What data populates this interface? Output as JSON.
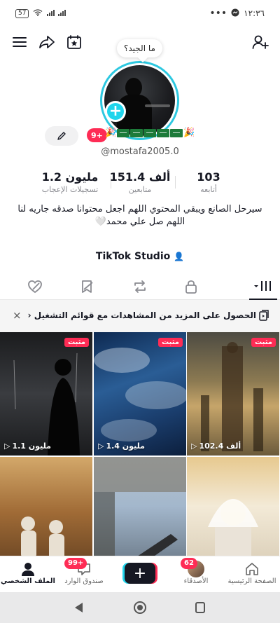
{
  "status_bar": {
    "battery": "57",
    "time": "١٢:٣٦"
  },
  "profile": {
    "bubble_text": "ما الجيد؟",
    "badge_count": "9+",
    "username": "@mostafa2005.0",
    "stats": [
      {
        "value": "103",
        "label": "أتابعه"
      },
      {
        "value": "151.4 ألف",
        "label": "متابعين"
      },
      {
        "value": "1.2 مليون",
        "label": "تسجيلات الإعجاب"
      }
    ],
    "bio_line1": "سيرحل الصانع ويبقي المحتوي اللهم اجعل محتوانا صدقه جاريه لنا",
    "bio_line2": "اللهم صل علي محمد🤍",
    "studio_label": "TikTok Studio"
  },
  "banner": {
    "text": "الحصول على المزيد من المشاهدات مع قوائم التشغيل ‹",
    "close": "×"
  },
  "videos": [
    {
      "pinned_label": "مثبت",
      "views": "1.1 مليون"
    },
    {
      "pinned_label": "مثبت",
      "views": "1.4 مليون"
    },
    {
      "pinned_label": "مثبت",
      "views": "102.4 ألف"
    },
    {
      "pinned_label": "",
      "views": ""
    },
    {
      "pinned_label": "",
      "views": ""
    },
    {
      "pinned_label": "",
      "views": ""
    }
  ],
  "bottom_nav": {
    "home": "الصفحة الرئيسية",
    "friends": "الأصدقاء",
    "friends_badge": "62",
    "inbox": "صندوق الوارد",
    "inbox_badge": "99+",
    "profile": "الملف الشخصي"
  },
  "colors": {
    "accent": "#fe2c55",
    "ring": "#2dc8e0"
  }
}
